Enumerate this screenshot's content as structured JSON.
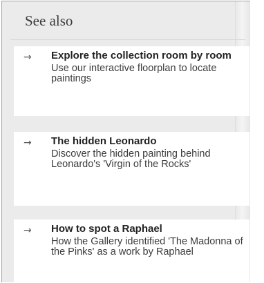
{
  "see_also": {
    "title": "See also",
    "items": [
      {
        "title": "Explore the collection room by room",
        "description": "Use our interactive floorplan to locate paintings",
        "icon": "arrow-right-icon",
        "arrow": "→"
      },
      {
        "title": "The hidden Leonardo",
        "description": "Discover the hidden painting behind Leonardo's 'Virgin of the Rocks'",
        "icon": "arrow-right-icon",
        "arrow": "→"
      },
      {
        "title": "How to spot a Raphael",
        "description": "How the Gallery identified 'The Madonna of the Pinks' as a work by Raphael",
        "icon": "arrow-right-icon",
        "arrow": "→"
      }
    ]
  }
}
